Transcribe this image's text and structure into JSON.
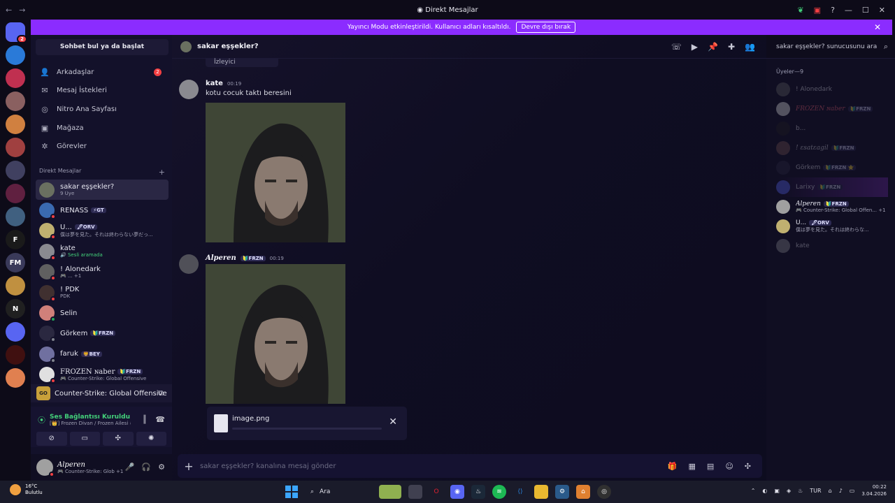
{
  "window": {
    "title": "Direkt Mesajlar"
  },
  "banner": {
    "text": "Yayıncı Modu etkinleştirildi. Kullanıcı adları kısaltıldı.",
    "button": "Devre dışı bırak"
  },
  "servers": [
    {
      "icon": "discord-home-icon",
      "color": "#5865f2",
      "badge": "2"
    },
    {
      "icon": "server-icon",
      "color": "#2a7ad8"
    },
    {
      "icon": "server-icon",
      "color": "#c03050"
    },
    {
      "icon": "server-icon",
      "color": "#8a6060"
    },
    {
      "icon": "server-icon",
      "color": "#d08040"
    },
    {
      "icon": "server-icon",
      "color": "#a04040"
    },
    {
      "icon": "server-icon",
      "color": "#404060"
    },
    {
      "icon": "server-icon",
      "color": "#602040"
    },
    {
      "icon": "server-icon",
      "color": "#406080"
    },
    {
      "icon": "server-icon",
      "color": "#1a1a1a",
      "label": "F"
    },
    {
      "icon": "server-icon",
      "color": "#3a3a5a",
      "label": "FM"
    },
    {
      "icon": "server-icon",
      "color": "#c09040"
    },
    {
      "icon": "server-icon",
      "color": "#202020",
      "label": "N"
    },
    {
      "icon": "server-icon",
      "color": "#5865f2"
    },
    {
      "icon": "server-icon",
      "color": "#401010"
    },
    {
      "icon": "server-icon",
      "color": "#e08050"
    }
  ],
  "sidebar": {
    "search_label": "Sohbet bul ya da başlat",
    "nav": [
      {
        "icon": "friends-icon",
        "label": "Arkadaşlar",
        "count": "2"
      },
      {
        "icon": "mail-icon",
        "label": "Mesaj İstekleri"
      },
      {
        "icon": "nitro-icon",
        "label": "Nitro Ana Sayfası"
      },
      {
        "icon": "shop-icon",
        "label": "Mağaza"
      },
      {
        "icon": "quests-icon",
        "label": "Görevler"
      }
    ],
    "dm_header": "Direkt Mesajlar",
    "dm_add": "+",
    "dms": [
      {
        "name": "sakar eşşekler?",
        "sub": "9 Üye",
        "tag": "",
        "color": "#6a7060"
      },
      {
        "name": "RENASS",
        "sub": "",
        "tag": "⚡GT",
        "color": "#3a6ab0",
        "status": "#f23f42"
      },
      {
        "name": "U...",
        "sub": "僕は夢を見た。それは終わらない夢だっ...",
        "tag": "🖋ORV",
        "color": "#c0b070",
        "status": "#f23f42"
      },
      {
        "name": "kate",
        "sub": "🔊 Sesli aramada",
        "tag": "",
        "color": "#8a8a90",
        "status": "#f23f42"
      },
      {
        "name": "! Alonedark",
        "sub": "🎮 ... +1",
        "tag": "",
        "color": "#606060",
        "status": "#f23f42"
      },
      {
        "name": "! PDK",
        "sub": "PDK",
        "tag": "",
        "color": "#403030",
        "status": "#f23f42"
      },
      {
        "name": "Selin",
        "sub": "",
        "tag": "",
        "color": "#d0807a",
        "status": "#23a55a"
      },
      {
        "name": "Görkem",
        "sub": "",
        "tag": "🔰FRZN",
        "color": "#2a2840",
        "status": "#80848e"
      },
      {
        "name": "faruk",
        "sub": "",
        "tag": "🦁BEY",
        "color": "#7070a0",
        "status": "#80848e"
      },
      {
        "name": "FROZEN ɴaber",
        "sub": "🎮 Counter-Strike: Global Offensive",
        "tag": "🔰FRZN",
        "color": "#e0e0e0",
        "status": "#f23f42"
      }
    ],
    "activity": {
      "icon_label": "GO",
      "title": "Counter-Strike: Global Offensive"
    },
    "voice": {
      "title": "Ses Bağlantısı Kuruldu",
      "subtitle": "[👑] Frozen Divan / Frozen Ailesi #Y..."
    },
    "user": {
      "name": "Alperen",
      "status": "🎮 Counter-Strike: Glob +1"
    }
  },
  "channel": {
    "name": "sakar eşşekler?",
    "search_placeholder": "sakar eşşekler? sunucusunu ara",
    "fragment_text": "İzleyici",
    "messages": [
      {
        "author": "kate",
        "time": "00:19",
        "text": "kotu cocuk taktı beresini",
        "author_tag": ""
      },
      {
        "author": "Alperen",
        "time": "00:19",
        "text": "",
        "author_tag": "🔰FRZN"
      }
    ],
    "upload": {
      "filename": "image.png"
    },
    "composer_placeholder": "sakar eşşekler? kanalına mesaj gönder"
  },
  "members": {
    "header": "Üyeler—9",
    "list": [
      {
        "name": "! Alonedark",
        "tag": "",
        "sub": "",
        "dim": true,
        "color": "#606060"
      },
      {
        "name": "FROZEN ɴaber",
        "tag": "🔰FRZN",
        "sub": "",
        "dim": true,
        "color": "#e0e0e0"
      },
      {
        "name": "b...",
        "tag": "",
        "sub": "",
        "dim": true,
        "color": "#202020"
      },
      {
        "name": "! ɛsatɛagil",
        "tag": "🔰FRZN",
        "sub": "",
        "dim": true,
        "color": "#705050"
      },
      {
        "name": "Görkem",
        "tag": "🔰FRZN ⭐",
        "sub": "",
        "dim": true,
        "color": "#2a2840"
      },
      {
        "name": "Larixy",
        "tag": "🔰FRZN",
        "sub": "",
        "dim": true,
        "color": "#5865f2"
      },
      {
        "name": "Alperen",
        "tag": "🔰FRZN",
        "sub": "🎮 Counter-Strike: Global Offen... +1",
        "dim": false,
        "color": "#a0a0a0"
      },
      {
        "name": "U...",
        "tag": "🖋ORV",
        "sub": "僕は夢を見た。それは終わらな...",
        "dim": false,
        "color": "#c0b070"
      },
      {
        "name": "kate",
        "tag": "",
        "sub": "",
        "dim": true,
        "color": "#8a8a90"
      }
    ]
  },
  "taskbar": {
    "temp": "16°C",
    "weather": "Bulutlu",
    "search": "Ara",
    "lang": "TUR",
    "time": "00:22",
    "date": "3.04.2026"
  }
}
